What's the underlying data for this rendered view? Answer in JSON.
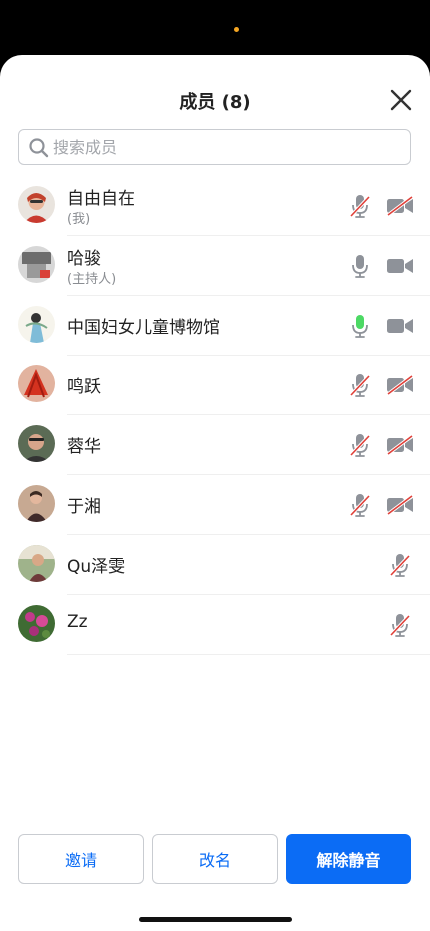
{
  "header": {
    "title": "成员 (8)"
  },
  "search": {
    "placeholder": "搜索成员"
  },
  "members": [
    {
      "name": "自由自在",
      "sub": "(我)",
      "mic": "muted",
      "cam": "off"
    },
    {
      "name": "哈骏",
      "sub": "(主持人)",
      "mic": "on",
      "cam": "on"
    },
    {
      "name": "中国妇女儿童博物馆",
      "sub": "",
      "mic": "speaking",
      "cam": "on"
    },
    {
      "name": "鸣跃",
      "sub": "",
      "mic": "muted",
      "cam": "off"
    },
    {
      "name": "蓉华",
      "sub": "",
      "mic": "muted",
      "cam": "off"
    },
    {
      "name": "于湘",
      "sub": "",
      "mic": "muted",
      "cam": "off"
    },
    {
      "name": "Qu泽雯",
      "sub": "",
      "mic": "muted",
      "cam": "none"
    },
    {
      "name": "Zz",
      "sub": "",
      "mic": "muted",
      "cam": "none"
    }
  ],
  "footer": {
    "invite": "邀请",
    "rename": "改名",
    "unmute": "解除静音"
  },
  "colors": {
    "accent": "#0b6cf5",
    "speaking": "#4cd964",
    "muted_slash": "#e0413a",
    "icon": "#8e9299"
  },
  "icons": {
    "close": "close-icon",
    "search": "search-icon",
    "mic": "microphone-icon",
    "camera": "video-camera-icon"
  }
}
